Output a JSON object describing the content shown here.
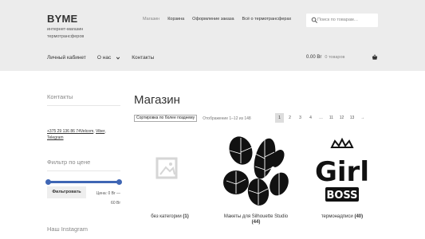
{
  "header": {
    "site_title": "BYME",
    "tagline": "интернет-магазин термотрансферов",
    "topnav": [
      "Магазин",
      "Корзина",
      "Оформление заказа",
      "Всё о термотрансферах"
    ],
    "search_placeholder": "Поиск по товарам…"
  },
  "mainnav": {
    "account": "Личный кабинет",
    "about": "О нас",
    "contacts": "Контакты"
  },
  "cart": {
    "amount": "0.00 Br",
    "count": "0 товаров"
  },
  "sidebar": {
    "contacts_title": "Контакты",
    "contact_line1": "+375 29 136 86 74Velcom",
    "contact_viber": "Viber",
    "contact_telegram": "Telegram",
    "filter_title": "Фильтр по цене",
    "filter_button": "Фильтровать",
    "price_line1": "Цена: 0 Br —",
    "price_line2": "60 Br",
    "instagram_title": "Наш Instagram",
    "price_range": [
      0,
      60
    ]
  },
  "shop": {
    "title": "Магазин",
    "sort_selected": "Сортировка по более позднему",
    "result_count": "Отображение 1–12 из 148",
    "pagination": [
      "1",
      "2",
      "3",
      "4",
      "…",
      "11",
      "12",
      "13",
      "→"
    ],
    "current_page": "1"
  },
  "products": [
    {
      "name": "без категории",
      "count": "(1)"
    },
    {
      "name": "Макеты для Silhouette Studio",
      "count": "(44)"
    },
    {
      "name": "термонадписи",
      "count": "(40)"
    }
  ],
  "colors": {
    "accent": "#3f66b4",
    "header_bg": "#ececec"
  }
}
